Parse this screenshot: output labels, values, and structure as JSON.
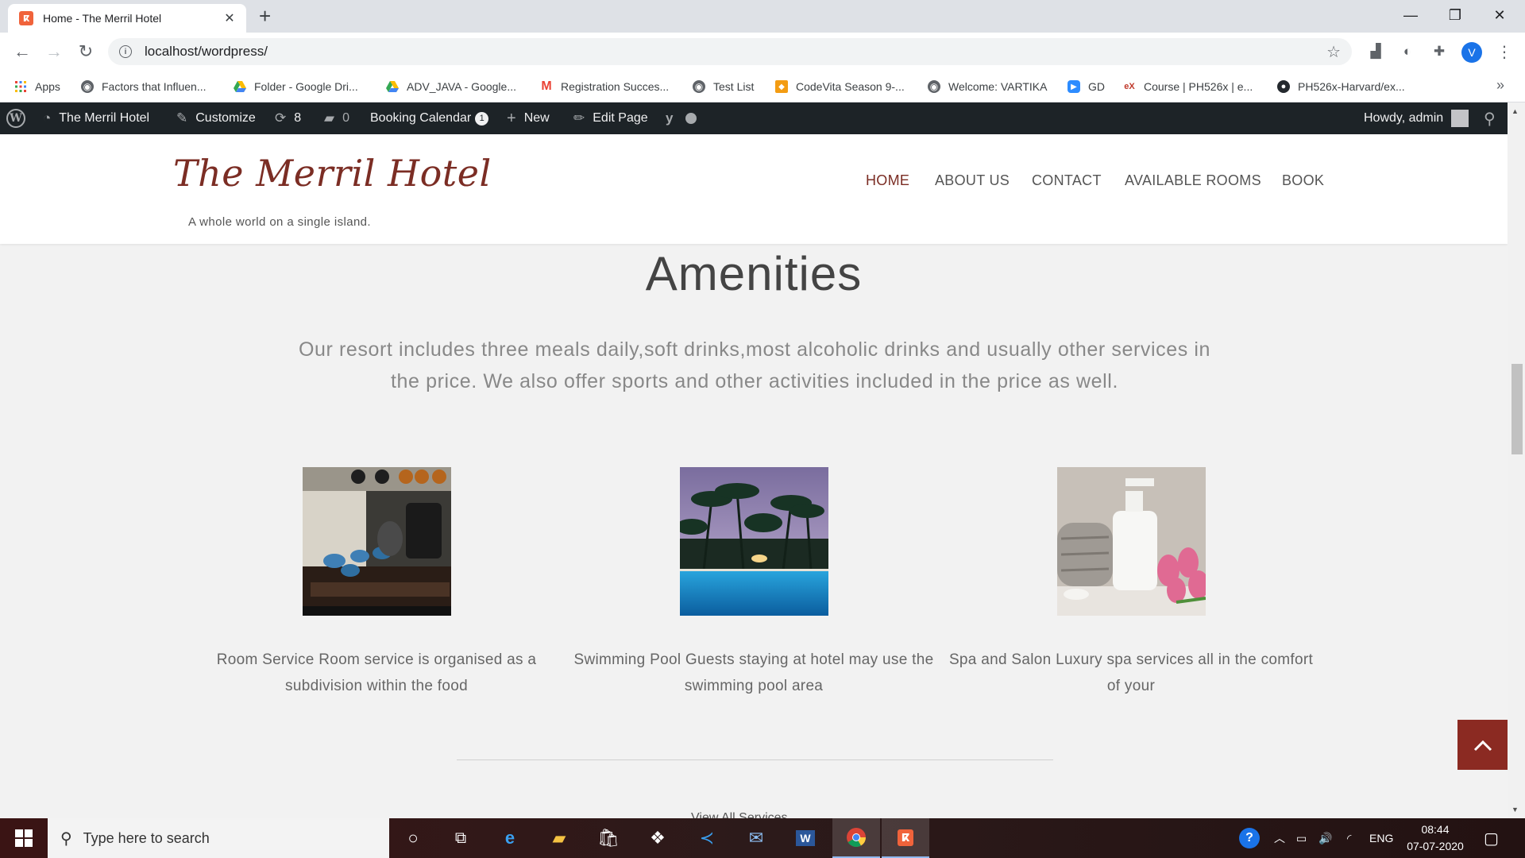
{
  "browser": {
    "tab_title": "Home - The Merril Hotel",
    "tab_close": "✕",
    "new_tab": "+",
    "url": "localhost/wordpress/",
    "profile_initial": "V",
    "bookmarks": [
      {
        "label": "Apps",
        "icon": "apps-grid-icon"
      },
      {
        "label": "Factors that Influen...",
        "icon": "globe-icon"
      },
      {
        "label": "Folder - Google Dri...",
        "icon": "google-drive-icon"
      },
      {
        "label": "ADV_JAVA - Google...",
        "icon": "google-drive-icon"
      },
      {
        "label": "Registration Succes...",
        "icon": "gmail-icon"
      },
      {
        "label": "Test List",
        "icon": "globe-icon"
      },
      {
        "label": "CodeVita Season 9-...",
        "icon": "codevita-icon"
      },
      {
        "label": "Welcome: VARTIKA",
        "icon": "globe-icon"
      },
      {
        "label": "GD",
        "icon": "zoom-icon"
      },
      {
        "label": "Course | PH526x | e...",
        "icon": "edx-icon"
      },
      {
        "label": "PH526x-Harvard/ex...",
        "icon": "github-icon"
      }
    ]
  },
  "adminbar": {
    "site_name": "The Merril Hotel",
    "customize": "Customize",
    "updates_count": "8",
    "comments_count": "0",
    "booking_calendar": "Booking Calendar",
    "booking_badge": "1",
    "new": "New",
    "edit_page": "Edit Page",
    "howdy": "Howdy, admin"
  },
  "header": {
    "site_title": "The Merril Hotel",
    "tagline": "A whole world on a single island.",
    "nav": [
      {
        "label": "HOME",
        "active": true
      },
      {
        "label": "ABOUT US",
        "active": false
      },
      {
        "label": "CONTACT",
        "active": false
      },
      {
        "label": "AVAILABLE ROOMS",
        "active": false
      },
      {
        "label": "BOOK",
        "active": false
      }
    ]
  },
  "amenities": {
    "title": "Amenities",
    "intro": "Our resort includes three meals daily,soft drinks,most alcoholic drinks and usually other services in the price. We also offer sports and other activities included in the price as well.",
    "items": [
      {
        "caption": "Room Service Room service is organised as a subdivision within the food",
        "image": "tea-set-photo"
      },
      {
        "caption": "Swimming Pool Guests staying at hotel may use the swimming pool area",
        "image": "pool-palms-photo"
      },
      {
        "caption": "Spa and Salon Luxury spa services all in the comfort of your",
        "image": "spa-products-photo"
      }
    ],
    "more_link": "View All Services"
  },
  "taskbar": {
    "search_placeholder": "Type here to search",
    "lang": "ENG",
    "time": "08:44",
    "date": "07-07-2020"
  },
  "colors": {
    "brand": "#7b2d24",
    "to_top": "#8b2a22",
    "adminbar": "#1d2327"
  }
}
